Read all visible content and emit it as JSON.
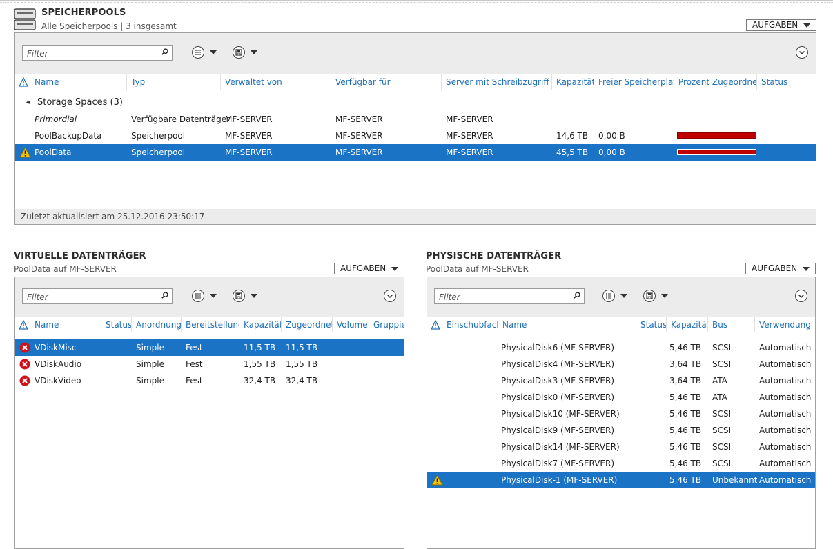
{
  "window": {
    "pools": {
      "title": "SPEICHERPOOLS",
      "subtitle": "Alle Speicherpools | 3 insgesamt",
      "tasks_label": "AUFGABEN",
      "filter_placeholder": "Filter",
      "columns": [
        "Name",
        "Typ",
        "Verwaltet von",
        "Verfügbar für",
        "Server mit Schreibzugriff",
        "Kapazität",
        "Freier Speicherplatz",
        "Prozent Zugeordnet",
        "Status"
      ],
      "group_label": "Storage Spaces (3)",
      "rows": [
        {
          "name": "Primordial",
          "typ": "Verfügbare Datenträger",
          "verwaltet": "MF-SERVER",
          "verfuegbar": "MF-SERVER",
          "server": "MF-SERVER",
          "kapazitaet": "",
          "frei": "",
          "percent_allocated": null,
          "status": "",
          "selected": false,
          "warning": false,
          "italic": true
        },
        {
          "name": "PoolBackupData",
          "typ": "Speicherpool",
          "verwaltet": "MF-SERVER",
          "verfuegbar": "MF-SERVER",
          "server": "MF-SERVER",
          "kapazitaet": "14,6 TB",
          "frei": "0,00 B",
          "percent_allocated": 100,
          "status": "",
          "selected": false,
          "warning": false,
          "italic": false
        },
        {
          "name": "PoolData",
          "typ": "Speicherpool",
          "verwaltet": "MF-SERVER",
          "verfuegbar": "MF-SERVER",
          "server": "MF-SERVER",
          "kapazitaet": "45,5 TB",
          "frei": "0,00 B",
          "percent_allocated": 100,
          "status": "",
          "selected": true,
          "warning": true,
          "italic": false
        }
      ],
      "footer": "Zuletzt aktualisiert am 25.12.2016 23:50:17",
      "accent_color": "#1a73c4",
      "bar_color": "#c00000"
    },
    "virtual": {
      "title": "VIRTUELLE DATENTRÄGER",
      "subtitle": "PoolData auf MF-SERVER",
      "tasks_label": "AUFGABEN",
      "filter_placeholder": "Filter",
      "columns": [
        "Name",
        "Status",
        "Anordnung",
        "Bereitstellung",
        "Kapazität",
        "Zugeordnet",
        "Volume",
        "Gruppiert"
      ],
      "rows": [
        {
          "name": "VDiskMisc",
          "status": "",
          "anordnung": "Simple",
          "bereitstellung": "Fest",
          "kapazitaet": "11,5 TB",
          "zugeordnet": "11,5 TB",
          "selected": true
        },
        {
          "name": "VDiskAudio",
          "status": "",
          "anordnung": "Simple",
          "bereitstellung": "Fest",
          "kapazitaet": "1,55 TB",
          "zugeordnet": "1,55 TB",
          "selected": false
        },
        {
          "name": "VDiskVideo",
          "status": "",
          "anordnung": "Simple",
          "bereitstellung": "Fest",
          "kapazitaet": "32,4 TB",
          "zugeordnet": "32,4 TB",
          "selected": false
        }
      ]
    },
    "physical": {
      "title": "PHYSISCHE DATENTRÄGER",
      "subtitle": "PoolData auf MF-SERVER",
      "tasks_label": "AUFGABEN",
      "filter_placeholder": "Filter",
      "columns": [
        "Einschubfach",
        "Name",
        "Status",
        "Kapazität",
        "Bus",
        "Verwendung"
      ],
      "rows": [
        {
          "slot": "",
          "name": "PhysicalDisk6 (MF-SERVER)",
          "status": "",
          "kapazitaet": "5,46 TB",
          "bus": "SCSI",
          "verwendung": "Automatisch",
          "selected": false,
          "warning": false
        },
        {
          "slot": "",
          "name": "PhysicalDisk4 (MF-SERVER)",
          "status": "",
          "kapazitaet": "3,64 TB",
          "bus": "SCSI",
          "verwendung": "Automatisch",
          "selected": false,
          "warning": false
        },
        {
          "slot": "",
          "name": "PhysicalDisk3 (MF-SERVER)",
          "status": "",
          "kapazitaet": "3,64 TB",
          "bus": "ATA",
          "verwendung": "Automatisch",
          "selected": false,
          "warning": false
        },
        {
          "slot": "",
          "name": "PhysicalDisk0 (MF-SERVER)",
          "status": "",
          "kapazitaet": "5,46 TB",
          "bus": "ATA",
          "verwendung": "Automatisch",
          "selected": false,
          "warning": false
        },
        {
          "slot": "",
          "name": "PhysicalDisk10 (MF-SERVER)",
          "status": "",
          "kapazitaet": "5,46 TB",
          "bus": "SCSI",
          "verwendung": "Automatisch",
          "selected": false,
          "warning": false
        },
        {
          "slot": "",
          "name": "PhysicalDisk9 (MF-SERVER)",
          "status": "",
          "kapazitaet": "5,46 TB",
          "bus": "SCSI",
          "verwendung": "Automatisch",
          "selected": false,
          "warning": false
        },
        {
          "slot": "",
          "name": "PhysicalDisk14 (MF-SERVER)",
          "status": "",
          "kapazitaet": "5,46 TB",
          "bus": "SCSI",
          "verwendung": "Automatisch",
          "selected": false,
          "warning": false
        },
        {
          "slot": "",
          "name": "PhysicalDisk7 (MF-SERVER)",
          "status": "",
          "kapazitaet": "5,46 TB",
          "bus": "SCSI",
          "verwendung": "Automatisch",
          "selected": false,
          "warning": false
        },
        {
          "slot": "",
          "name": "PhysicalDisk-1 (MF-SERVER)",
          "status": "",
          "kapazitaet": "5,46 TB",
          "bus": "Unbekannt",
          "verwendung": "Automatisch",
          "selected": true,
          "warning": true
        }
      ]
    }
  }
}
